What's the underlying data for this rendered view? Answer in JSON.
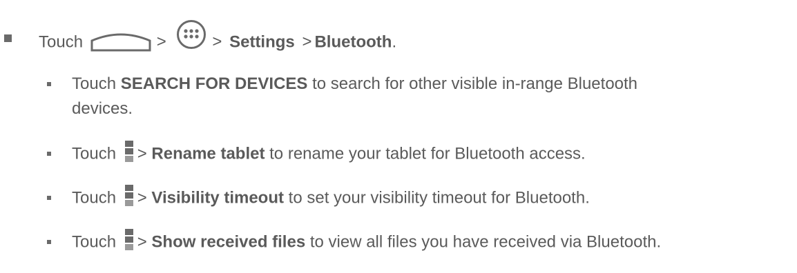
{
  "main_step": {
    "touch": "Touch",
    "sep1": ">",
    "sep2": ">",
    "settings": "Settings",
    "sep3": ">",
    "bluetooth": "Bluetooth",
    "end": "."
  },
  "sub_steps": [
    {
      "touch": "Touch",
      "bold": "SEARCH FOR DEVICES",
      "rest_line1": "to search for other visible in-range Bluetooth",
      "rest_line2": "devices."
    },
    {
      "touch": "Touch",
      "sep": ">",
      "bold": "Rename tablet",
      "rest": "to rename your tablet for Bluetooth access."
    },
    {
      "touch": "Touch",
      "sep": ">",
      "bold": "Visibility timeout",
      "rest": "to set your visibility timeout for Bluetooth."
    },
    {
      "touch": "Touch",
      "sep": ">",
      "bold": "Show received files",
      "rest": "to view all files you have received via Bluetooth."
    }
  ],
  "icons": {
    "home": "home-icon",
    "apps": "apps-icon",
    "menu": "menu-icon"
  }
}
